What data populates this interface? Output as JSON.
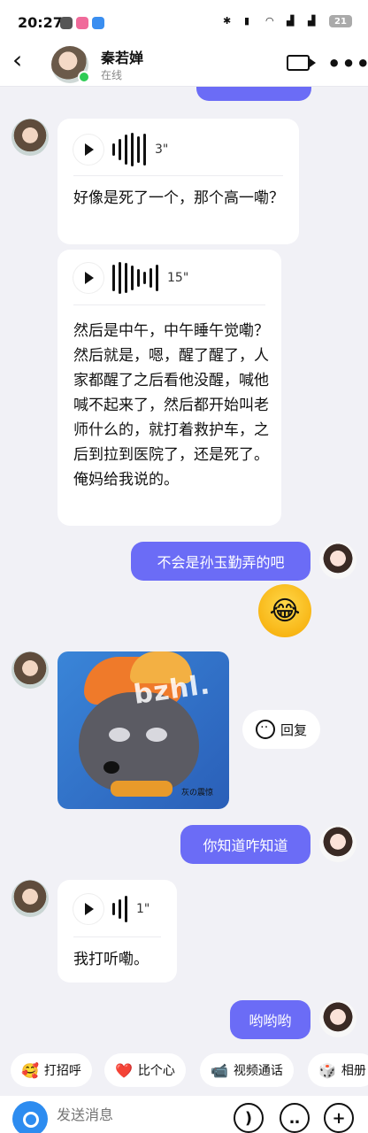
{
  "status_bar": {
    "time": "20:27",
    "battery": "21"
  },
  "header": {
    "name": "秦若婵",
    "status": "在线"
  },
  "messages": {
    "top_partial_text": "…",
    "voice1": {
      "duration": "3\"",
      "text": "好像是死了一个，那个高一嘞？"
    },
    "voice2": {
      "duration": "15\"",
      "text": "然后是中午，中午睡午觉嘞？然后就是，嗯，醒了醒了，人家都醒了之后看他没醒，喊他喊不起来了，然后都开始叫老师什么的，就打着救护车，之后到拉到医院了，还是死了。俺妈给我说的。"
    },
    "sent1": "不会是孙玉勤弄的吧",
    "emoji": "😂",
    "sticker_watermark": "bzhl.",
    "sticker_caption": "灰の震惊",
    "reply_label": "回复",
    "sent2": "你知道咋知道",
    "voice3": {
      "duration": "1\"",
      "text": "我打听嘞。"
    },
    "sent3": "哟哟哟"
  },
  "quick_actions": [
    {
      "icon": "🥰",
      "label": "打招呼"
    },
    {
      "icon": "❤️",
      "label": "比个心"
    },
    {
      "icon": "📹",
      "label": "视频通话"
    },
    {
      "icon": "🎲",
      "label": "相册"
    }
  ],
  "input": {
    "placeholder": "发送消息"
  },
  "colors": {
    "accent": "#6b6cf6",
    "online": "#2ecc55"
  }
}
